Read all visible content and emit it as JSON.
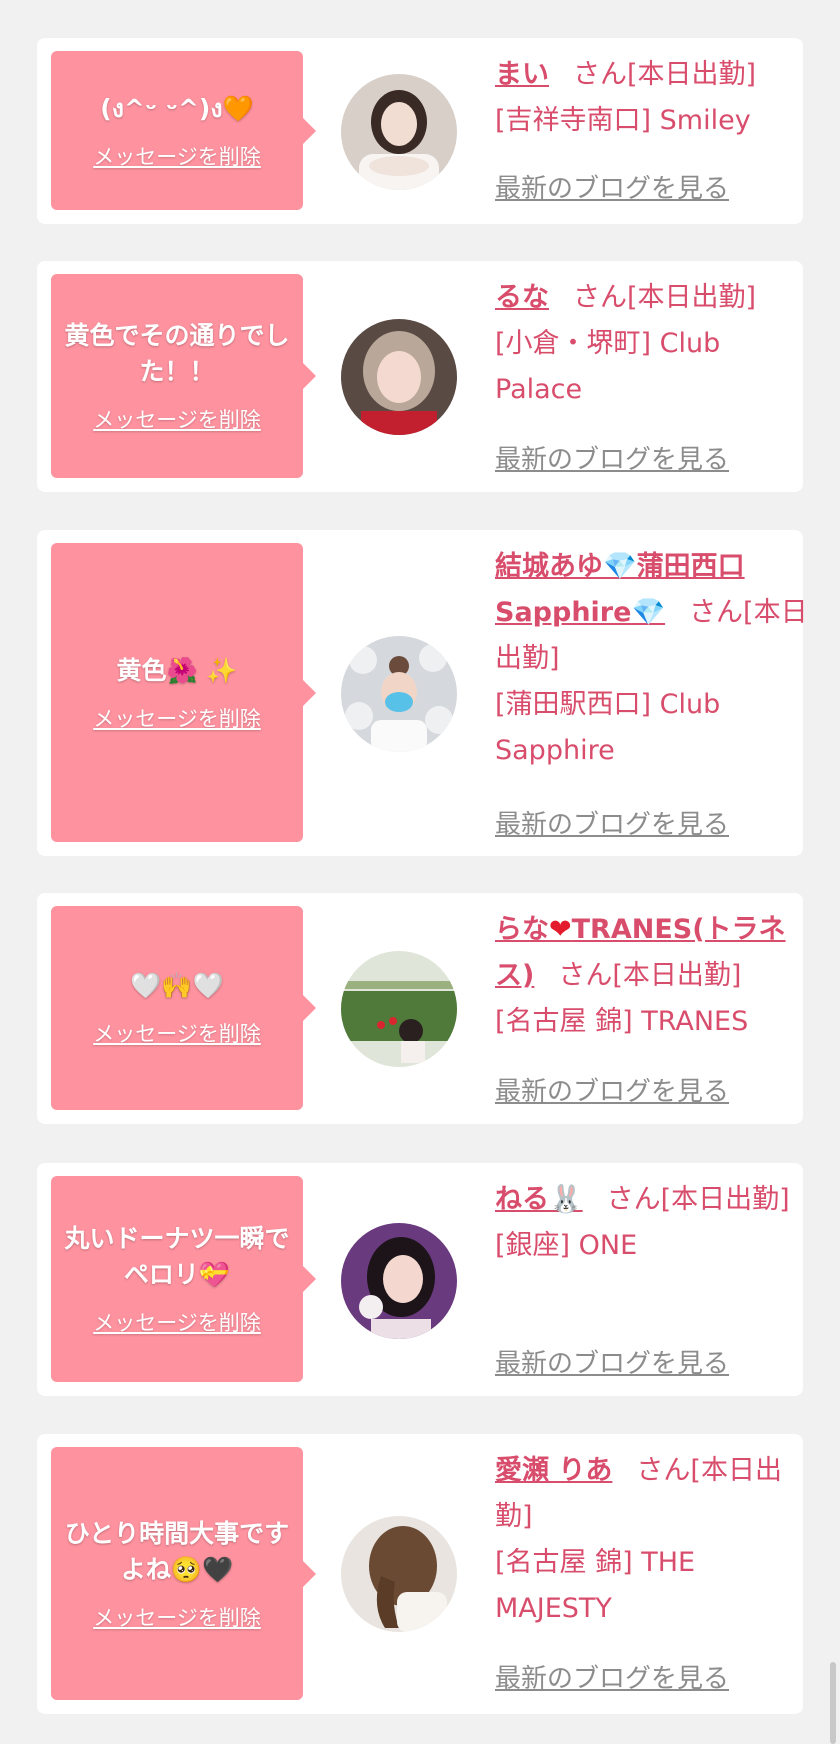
{
  "delete_label": "メッセージを削除",
  "blog_label": "最新のブログを見る",
  "honorific": "さん[本日出勤]",
  "cards": [
    {
      "message": "(ง^ᵕ ᵕ^)ง🧡",
      "name": "まい",
      "shop": "[吉祥寺南口] Smiley"
    },
    {
      "message": "黄色でその通りでした！！",
      "name": "るな",
      "shop": "[小倉・堺町] Club Palace"
    },
    {
      "message": "黄色🌺 ✨",
      "name_parts": [
        "結城あゆ",
        "💎",
        "蒲田西口Sapphire",
        "💎"
      ],
      "shop": "[蒲田駅西口] Club Sapphire"
    },
    {
      "message": "🤍🙌🤍",
      "name_parts": [
        "らな",
        "❤",
        "TRANES(トラネス)"
      ],
      "shop": "[名古屋 錦] TRANES"
    },
    {
      "message": "丸いドーナツ一瞬でペロリ💝",
      "name_parts": [
        "ねる",
        "🐰"
      ],
      "shop": "[銀座] ONE"
    },
    {
      "message": "ひとり時間大事ですよね🥺🖤",
      "name": "愛瀬 りあ",
      "shop": "[名古屋 錦] THE MAJESTY"
    }
  ],
  "colors": {
    "accent": "#d94d6c",
    "bubble": "#fe929f",
    "link_gray": "#8c8c8c",
    "background": "#f1f1f1"
  }
}
